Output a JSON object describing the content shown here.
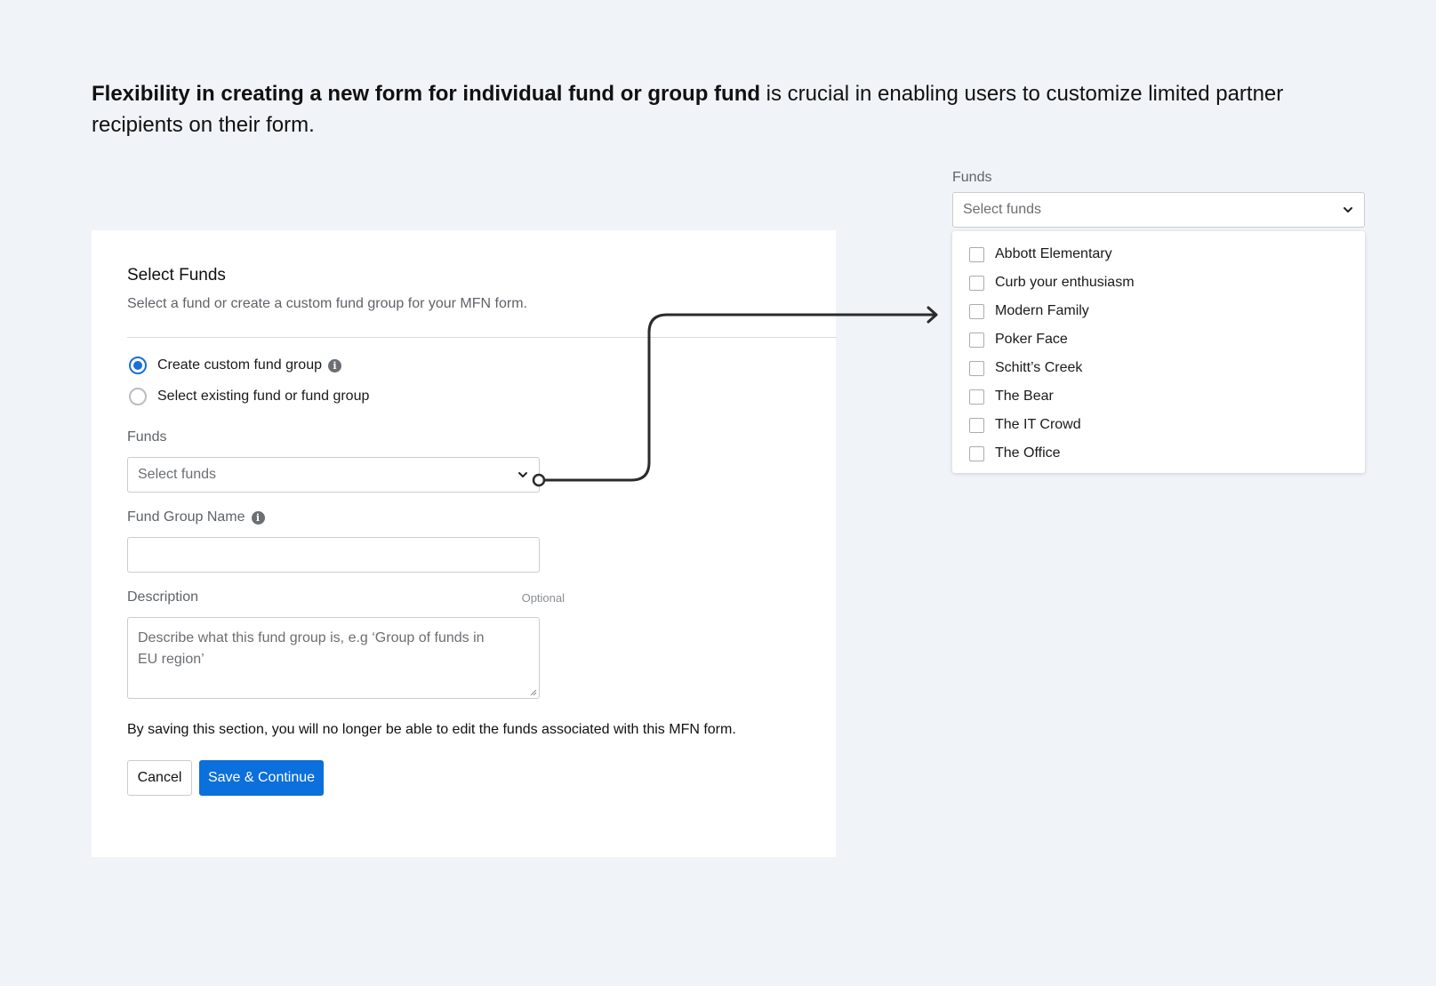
{
  "headline": {
    "bold": "Flexibility in creating a new form for individual fund or group fund",
    "rest": " is crucial in enabling users to customize limited partner recipients on their form."
  },
  "card": {
    "title": "Select Funds",
    "subtitle": "Select a fund or create a custom fund group for your MFN form.",
    "radio_options": [
      {
        "label": "Create custom fund group",
        "checked": true
      },
      {
        "label": "Select existing fund or fund group",
        "checked": false
      }
    ],
    "funds_label": "Funds",
    "funds_placeholder": "Select funds",
    "group_name_label": "Fund Group Name",
    "description_label": "Description",
    "description_optional": "Optional",
    "description_placeholder": "Describe what this fund group is, e.g ‘Group of funds in EU region’",
    "note": "By saving this section, you will no longer be able to edit the funds associated with this MFN form.",
    "cancel_label": "Cancel",
    "save_label": "Save & Continue"
  },
  "dropdown": {
    "label": "Funds",
    "placeholder": "Select funds",
    "options": [
      "Abbott Elementary",
      "Curb your enthusiasm",
      "Modern Family",
      "Poker Face",
      "Schitt’s Creek",
      "The Bear",
      "The IT Crowd",
      "The Office"
    ]
  },
  "colors": {
    "background": "#f0f4f8",
    "primary": "#0b6fdc",
    "radio_checked": "#1a6fd8",
    "connector": "#2b2b2b"
  },
  "icons": [
    "info-icon",
    "chevron-down-icon",
    "arrow-right-icon",
    "resize-grip-icon"
  ]
}
